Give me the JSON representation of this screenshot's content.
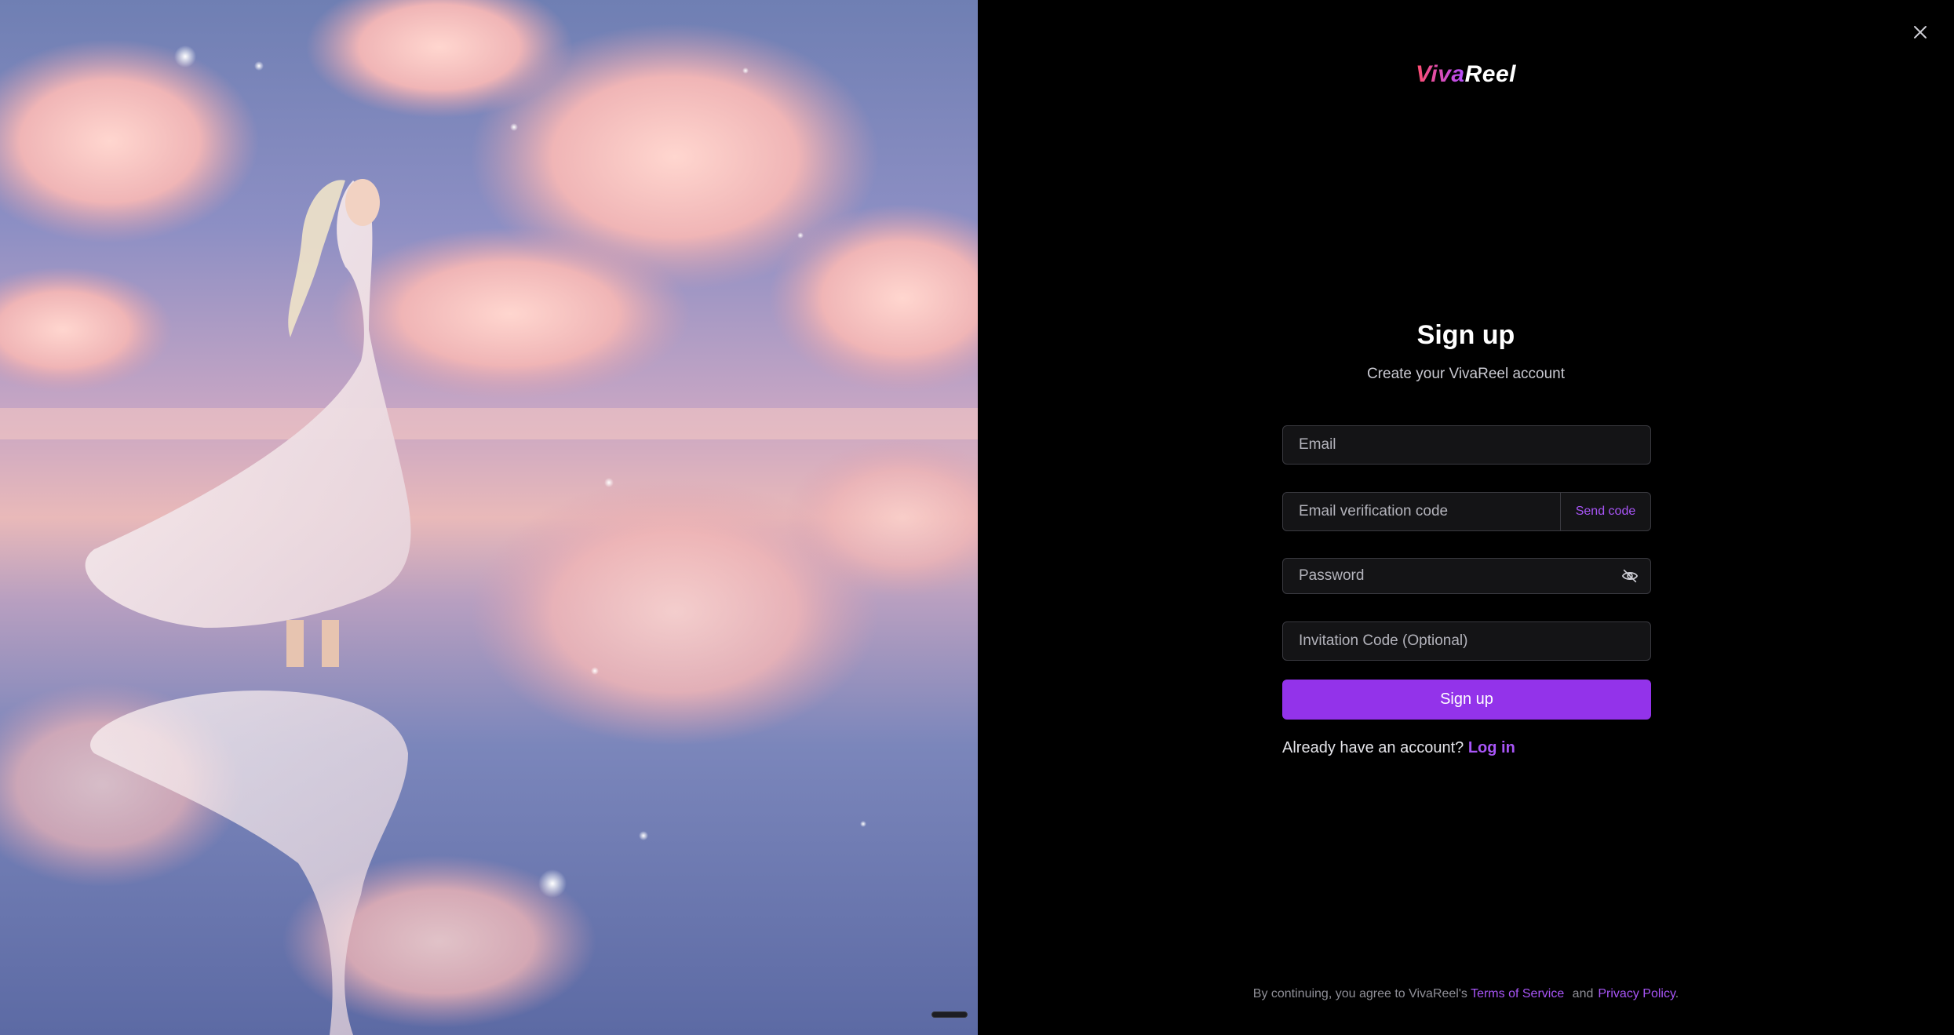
{
  "brand": {
    "logo_part1": "Viva",
    "logo_part2": "Reel"
  },
  "form": {
    "title": "Sign up",
    "subtitle": "Create your VivaReel account",
    "email_placeholder": "Email",
    "code_placeholder": "Email verification code",
    "send_code_label": "Send code",
    "password_placeholder": "Password",
    "invite_placeholder": "Invitation Code (Optional)",
    "submit_label": "Sign up",
    "already_text": "Already have an account?",
    "login_label": "Log in"
  },
  "legal": {
    "prefix": "By continuing, you agree to VivaReel's",
    "terms_label": "Terms of Service",
    "and": "and",
    "privacy_label": "Privacy Policy",
    "suffix": "."
  },
  "icons": {
    "close": "close-icon",
    "password_toggle": "eye-off-icon"
  },
  "colors": {
    "accent": "#9333ea",
    "link": "#a855f7",
    "background": "#000000",
    "input_bg": "#141416"
  }
}
